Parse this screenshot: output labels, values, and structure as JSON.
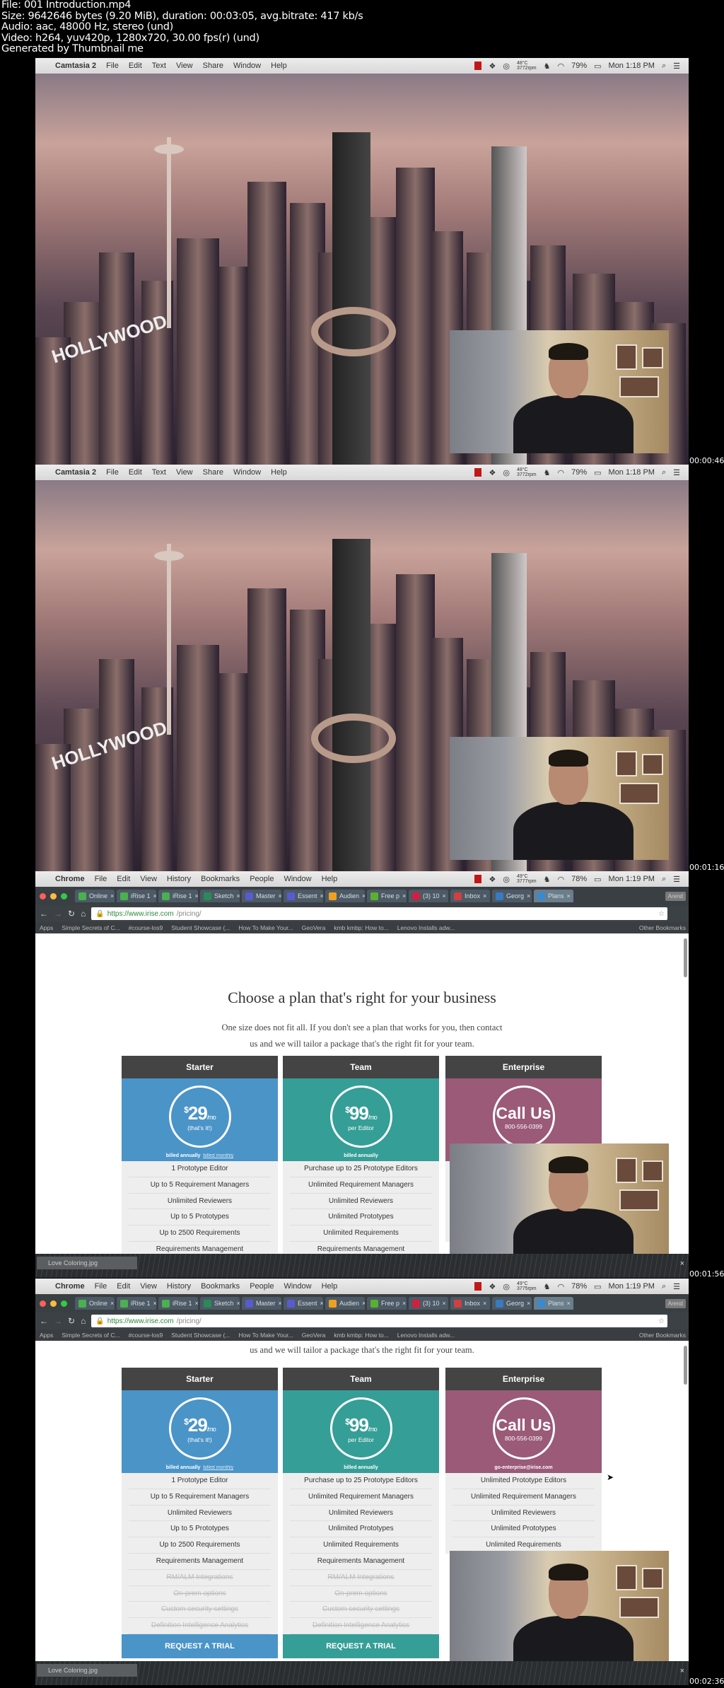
{
  "file_info": [
    "File: 001 Introduction.mp4",
    "Size: 9642646 bytes (9.20 MiB), duration: 00:03:05, avg.bitrate: 417 kb/s",
    "Audio: aac, 48000 Hz, stereo (und)",
    "Video: h264, yuv420p, 1280x720, 30.00 fps(r) (und)",
    "Generated by Thumbnail me"
  ],
  "frames": [
    {
      "timestamp": "00:00:46",
      "app": "Camtasia 2",
      "menus": [
        "File",
        "Edit",
        "Text",
        "View",
        "Share",
        "Window",
        "Help"
      ],
      "temp": "48°C",
      "rpm": "3772rpm",
      "battery": "79%",
      "clock": "Mon 1:18 PM"
    },
    {
      "timestamp": "00:01:16",
      "app": "Camtasia 2",
      "menus": [
        "File",
        "Edit",
        "Text",
        "View",
        "Share",
        "Window",
        "Help"
      ],
      "temp": "48°C",
      "rpm": "3772rpm",
      "battery": "79%",
      "clock": "Mon 1:18 PM"
    },
    {
      "timestamp": "00:01:56",
      "app": "Chrome",
      "menus": [
        "File",
        "Edit",
        "View",
        "History",
        "Bookmarks",
        "People",
        "Window",
        "Help"
      ],
      "temp": "49°C",
      "rpm": "3777rpm",
      "battery": "78%",
      "clock": "Mon 1:19 PM"
    },
    {
      "timestamp": "00:02:36",
      "app": "Chrome",
      "menus": [
        "File",
        "Edit",
        "View",
        "History",
        "Bookmarks",
        "People",
        "Window",
        "Help"
      ],
      "temp": "49°C",
      "rpm": "3775rpm",
      "battery": "78%",
      "clock": "Mon 1:19 PM"
    }
  ],
  "browser": {
    "tabs": [
      {
        "label": "Online",
        "color": "#4caf50",
        "icon": "U"
      },
      {
        "label": "iRise 1",
        "color": "#4caf50",
        "icon": "U"
      },
      {
        "label": "iRise 1",
        "color": "#4caf50",
        "icon": "U"
      },
      {
        "label": "Sketch",
        "color": "#2a8a5a",
        "icon": "N"
      },
      {
        "label": "Master",
        "color": "#5a5ad0",
        "icon": "+"
      },
      {
        "label": "Essent",
        "color": "#5a5ad0",
        "icon": "+"
      },
      {
        "label": "Audien",
        "color": "#f0a020",
        "icon": "▟"
      },
      {
        "label": "Free p",
        "color": "#5ab030",
        "icon": "px"
      },
      {
        "label": "(3) 10",
        "color": "#d02040",
        "icon": "P"
      },
      {
        "label": "Inbox",
        "color": "#d04040",
        "icon": "M"
      },
      {
        "label": "Georg",
        "color": "#3a7ac0",
        "icon": "◉"
      },
      {
        "label": "Plans",
        "color": "#3a8ad0",
        "icon": "▶"
      }
    ],
    "profile": "Arend",
    "url_host": "https://www.irise.com",
    "url_path": "/pricing/",
    "bookmarks": [
      "Apps",
      "Simple Secrets of C...",
      "#course-los9",
      "Student Showcase (...",
      "How To Make Your...",
      "GeoVera",
      "kmb kmbp: How to...",
      "Lenovo Installs adw..."
    ],
    "other_bookmarks": "Other Bookmarks",
    "download_file": "Love Coloring.jpg"
  },
  "pricing": {
    "title": "Choose a plan that's right for your business",
    "subtitle_1": "One size does not fit all. If you don't see a plan that works for you, then contact",
    "subtitle_2": "us and we will tailor a package that's the right fit for your team.",
    "plans": [
      {
        "name": "Starter",
        "color": "#4a94c8",
        "amount": "29",
        "per": "/mo",
        "sub": "(that's it!)",
        "billing": "billed annually",
        "billing_alt": "billed monthly",
        "cta": "REQUEST A TRIAL",
        "features": [
          [
            "1 Prototype Editor",
            true
          ],
          [
            "Up to 5 Requirement Managers",
            true
          ],
          [
            "Unlimited Reviewers",
            true
          ],
          [
            "Up to 5 Prototypes",
            true
          ],
          [
            "Up to 2500 Requirements",
            true
          ],
          [
            "Requirements Management",
            true
          ],
          [
            "RM/ALM Integrations",
            false
          ],
          [
            "On-prem options",
            false
          ],
          [
            "Custom security settings",
            false
          ],
          [
            "Definition Intelligence Analytics",
            false
          ]
        ]
      },
      {
        "name": "Team",
        "color": "#359e97",
        "amount": "99",
        "per": "/mo",
        "sub": "per Editor",
        "billing": "billed annually",
        "billing_alt": "",
        "cta": "REQUEST A TRIAL",
        "features": [
          [
            "Purchase up to 25 Prototype Editors",
            true
          ],
          [
            "Unlimited Requirement Managers",
            true
          ],
          [
            "Unlimited Reviewers",
            true
          ],
          [
            "Unlimited Prototypes",
            true
          ],
          [
            "Unlimited Requirements",
            true
          ],
          [
            "Requirements Management",
            true
          ],
          [
            "RM/ALM Integrations",
            false
          ],
          [
            "On-prem options",
            false
          ],
          [
            "Custom security settings",
            false
          ],
          [
            "Definition Intelligence Analytics",
            false
          ]
        ]
      },
      {
        "name": "Enterprise",
        "color": "#9a5a78",
        "call": "Call Us",
        "phone": "800-556-0399",
        "email": "go-enterprise@irise.com",
        "features": [
          [
            "Unlimited Prototype Editors",
            true
          ],
          [
            "Unlimited Requirement Managers",
            true
          ],
          [
            "Unlimited Reviewers",
            true
          ],
          [
            "Unlimited Prototypes",
            true
          ],
          [
            "Unlimited Requirements",
            true
          ]
        ]
      }
    ]
  }
}
